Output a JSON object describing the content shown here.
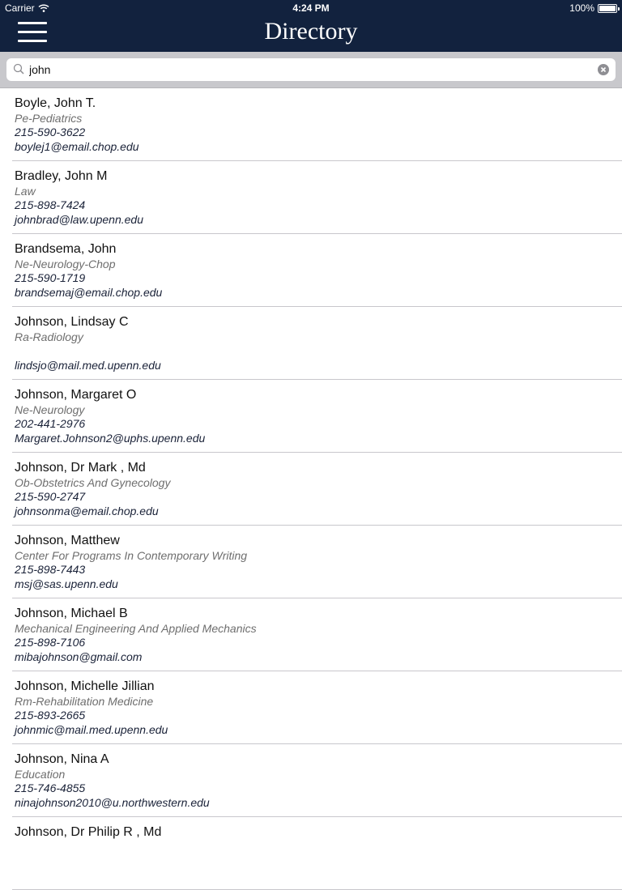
{
  "status_bar": {
    "carrier": "Carrier",
    "time": "4:24 PM",
    "battery": "100%"
  },
  "navbar": {
    "title": "Directory"
  },
  "search": {
    "value": "john",
    "placeholder": ""
  },
  "results": [
    {
      "name": "Boyle, John T.",
      "department": "Pe-Pediatrics",
      "phone": "215-590-3622",
      "email": "boylej1@email.chop.edu"
    },
    {
      "name": "Bradley, John M",
      "department": "Law",
      "phone": "215-898-7424",
      "email": "johnbrad@law.upenn.edu"
    },
    {
      "name": "Brandsema, John",
      "department": "Ne-Neurology-Chop",
      "phone": "215-590-1719",
      "email": "brandsemaj@email.chop.edu"
    },
    {
      "name": "Johnson, Lindsay C",
      "department": "Ra-Radiology",
      "phone": "",
      "email": "lindsjo@mail.med.upenn.edu"
    },
    {
      "name": "Johnson, Margaret O",
      "department": "Ne-Neurology",
      "phone": "202-441-2976",
      "email": "Margaret.Johnson2@uphs.upenn.edu"
    },
    {
      "name": "Johnson, Dr Mark , Md",
      "department": "Ob-Obstetrics And Gynecology",
      "phone": "215-590-2747",
      "email": "johnsonma@email.chop.edu"
    },
    {
      "name": "Johnson, Matthew",
      "department": "Center For Programs In Contemporary Writing",
      "phone": "215-898-7443",
      "email": "msj@sas.upenn.edu"
    },
    {
      "name": "Johnson, Michael B",
      "department": "Mechanical Engineering And Applied Mechanics",
      "phone": "215-898-7106",
      "email": "mibajohnson@gmail.com"
    },
    {
      "name": "Johnson, Michelle Jillian",
      "department": "Rm-Rehabilitation Medicine",
      "phone": "215-893-2665",
      "email": "johnmic@mail.med.upenn.edu"
    },
    {
      "name": "Johnson, Nina A",
      "department": "Education",
      "phone": "215-746-4855",
      "email": "ninajohnson2010@u.northwestern.edu"
    },
    {
      "name": "Johnson, Dr Philip R , Md",
      "department": "",
      "phone": "",
      "email": ""
    }
  ]
}
